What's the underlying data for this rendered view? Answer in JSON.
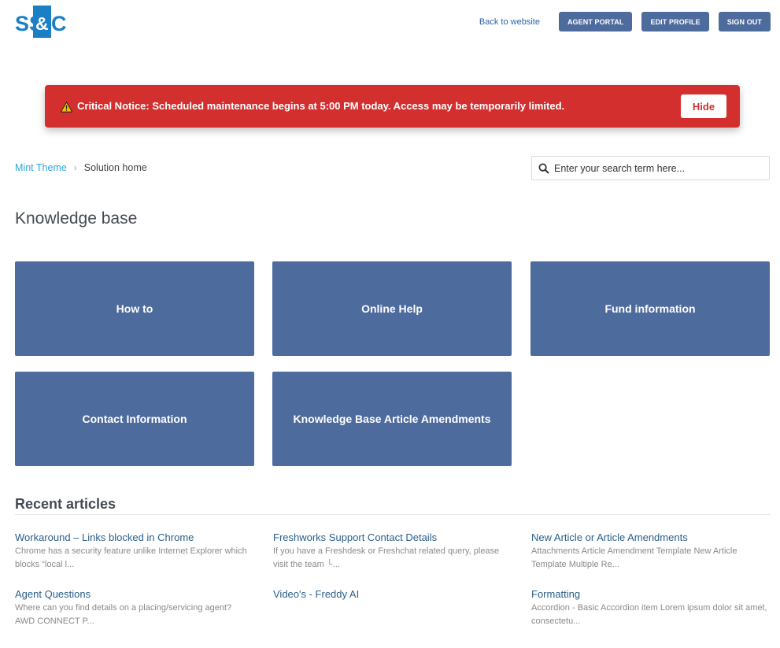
{
  "header": {
    "logo_text": "SS&C",
    "back_link": "Back to website",
    "buttons": [
      "AGENT PORTAL",
      "EDIT PROFILE",
      "SIGN OUT"
    ]
  },
  "notice": {
    "label": "Critical Notice:",
    "message": "Scheduled maintenance begins at 5:00 PM today. Access may be temporarily limited.",
    "hide_label": "Hide"
  },
  "breadcrumb": {
    "items": [
      "Mint Theme",
      "Solution home"
    ],
    "separator": "›"
  },
  "search": {
    "placeholder": "Enter your search term here..."
  },
  "page_title": "Knowledge base",
  "categories": [
    "How to",
    "Online Help",
    "Fund information",
    "Contact Information",
    "Knowledge Base Article Amendments"
  ],
  "recent": {
    "title": "Recent articles",
    "articles": [
      {
        "title": "Workaround – Links blocked in Chrome",
        "snippet": "Chrome has a security feature unlike Internet Explorer which blocks “local l..."
      },
      {
        "title": "Freshworks Support Contact Details",
        "snippet": "If you have a Freshdesk or Freshchat related query, please visit the team └..."
      },
      {
        "title": "New Article or Article Amendments",
        "snippet": "Attachments Article Amendment Template New Article Template Multiple Re..."
      },
      {
        "title": "Agent Questions",
        "snippet": "Where can you find details on a placing/servicing agent? AWD CONNECT P..."
      },
      {
        "title": "Video's - Freddy AI",
        "snippet": ""
      },
      {
        "title": "Formatting",
        "snippet": "Accordion - Basic Accordion item Lorem ipsum dolor sit amet, consectetu..."
      }
    ]
  },
  "colors": {
    "brand_blue": "#1b7fc6",
    "tile_blue": "#4e6b9e",
    "nav_button": "#4d6b9c",
    "notice_red": "#d32f2f",
    "link_blue": "#2a5f8a",
    "breadcrumb_link": "#2ba6df"
  },
  "icons": [
    "warning-icon",
    "search-icon"
  ]
}
